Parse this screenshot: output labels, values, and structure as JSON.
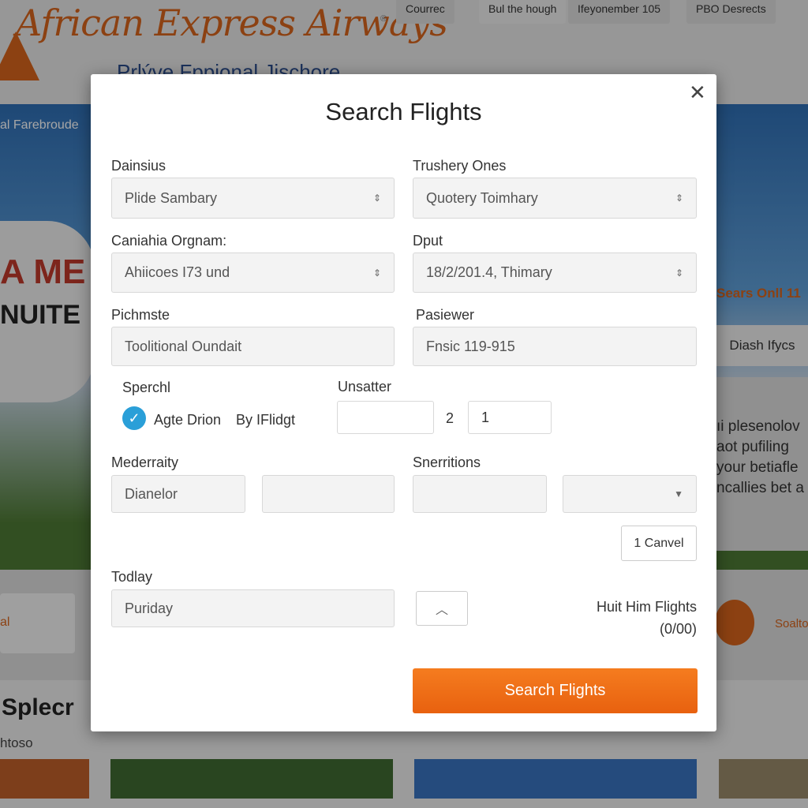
{
  "brand": {
    "name": "African Express Airways",
    "registered": "®",
    "tagline": "Prlýve Fppional Jischore"
  },
  "nav": {
    "tabs": [
      "Courrec",
      "Bul the hough",
      "Ifeyonember 105",
      "PBO Desrects"
    ]
  },
  "background": {
    "banner_text": "al Farebroude",
    "plane_text_1": "A ME",
    "plane_text_2": "NUITE",
    "promo_title": "Sears Onll 11",
    "promo_button": "Diash Ifycs",
    "promo_lines": [
      "ıi plesenolov",
      "aot pufiling",
      "your betiafle",
      "ncallies bet a"
    ],
    "side_link": "Soalto",
    "section_title": "Splecr",
    "section_sub": "htoso",
    "left_card": "al"
  },
  "modal": {
    "title": "Search Flights",
    "close_icon": "close-icon",
    "fields": {
      "f1": {
        "label": "Dainsius",
        "value": "Plide Sambary"
      },
      "f2": {
        "label": "Trushery Ones",
        "value": "Quotery Toimhary"
      },
      "f3": {
        "label": "Caniahia Orgnam:",
        "value": "Ahiicoes I73 und"
      },
      "f4": {
        "label": "Dput",
        "value": "18/2/201.4, Thimary"
      },
      "f5": {
        "label": "Pichmste",
        "value": "Toolitional Oundait"
      },
      "f6": {
        "label": "Pasiewer",
        "value": "Fnsic 119-915"
      }
    },
    "options": {
      "label": "Sperchl",
      "checkbox_label": "Agte Drion",
      "checked": true,
      "extra": "By IFlidgt"
    },
    "passengers": {
      "label": "Unsatter",
      "value1": "",
      "separator": "2",
      "value2": "1"
    },
    "mederraity": {
      "label": "Mederraity",
      "value1": "Dianelor",
      "value2": ""
    },
    "snerritions": {
      "label": "Snerritions",
      "value1": "",
      "value2": ""
    },
    "cancel_label": "1 Canvel",
    "today": {
      "label": "Todlay",
      "value": "Puriday"
    },
    "hint": {
      "text": "Huit Him Flights",
      "count": "(0/00)"
    },
    "submit_label": "Search Flights",
    "accent": "#f0701a"
  }
}
